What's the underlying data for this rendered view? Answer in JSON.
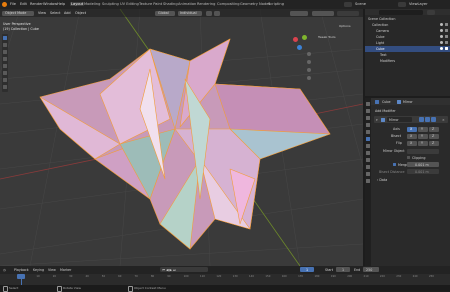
{
  "menu": {
    "items": [
      "File",
      "Edit",
      "Render",
      "Window",
      "Help"
    ],
    "workspaces": [
      "Layout",
      "Modeling",
      "Sculpting",
      "UV Editing",
      "Texture Paint",
      "Shading",
      "Animation",
      "Rendering",
      "Compositing",
      "Geometry Nodes",
      "Scripting"
    ],
    "active_workspace": "Layout",
    "scene": "Scene",
    "view_layer": "ViewLayer"
  },
  "viewport": {
    "mode": "Object Mode",
    "menus": [
      "View",
      "Select",
      "Add",
      "Object"
    ],
    "transform": "Global",
    "pivot": "Individual",
    "perspective_label": "User Perspective",
    "collection_label": "(19) Collection | Cube",
    "options_label": "Options",
    "tools_label": "Tweak Tools",
    "colors": {
      "background": "#3a3a3a",
      "grid": "#474747",
      "x_axis": "#8b3a3a",
      "y_axis": "#6d8a2a",
      "object": "#d8a7cf",
      "outline": "#f29d38"
    }
  },
  "outliner": {
    "title": "Scene Collection",
    "items": [
      {
        "label": "Scene Collection",
        "icon": "collection-icon"
      },
      {
        "label": "Collection",
        "icon": "collection-icon"
      },
      {
        "label": "Camera",
        "icon": "camera-icon"
      },
      {
        "label": "Cube",
        "icon": "mesh-icon"
      },
      {
        "label": "Light",
        "icon": "light-icon"
      },
      {
        "label": "Cube",
        "icon": "mesh-icon"
      },
      {
        "label": "Text",
        "icon": "text-icon"
      },
      {
        "label": "Modifiers",
        "icon": "wrench-icon"
      }
    ],
    "selected_index": 5
  },
  "properties": {
    "object_name": "Cube",
    "add_modifier": "Add Modifier",
    "modifier_name": "Mirror",
    "axis_label": "Axis",
    "bisect_label": "Bisect",
    "flip_label": "Flip",
    "axes": [
      "X",
      "Y",
      "Z"
    ],
    "mirror_object_label": "Mirror Object",
    "clipping_label": "Clipping",
    "merge_label": "Merge",
    "merge_value": "0.001 m",
    "bisect_distance_label": "Bisect Distance",
    "bisect_distance_value": "0.001 m",
    "data_label": "Data"
  },
  "timeline": {
    "menus": [
      "Playback",
      "Keying",
      "View",
      "Marker"
    ],
    "current_frame": "1",
    "start_label": "Start",
    "start": "1",
    "end_label": "End",
    "end": "250",
    "ticks": [
      "0",
      "10",
      "20",
      "30",
      "40",
      "50",
      "60",
      "70",
      "80",
      "90",
      "100",
      "110",
      "120",
      "130",
      "140",
      "150",
      "160",
      "170",
      "180",
      "190",
      "200",
      "210",
      "220",
      "230",
      "240",
      "250"
    ]
  },
  "status": {
    "select": "Select",
    "rotate": "Rotate View",
    "context": "Object Context Menu"
  }
}
